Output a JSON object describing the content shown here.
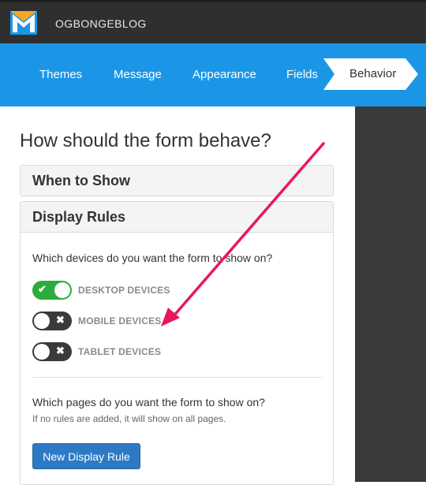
{
  "header": {
    "brand": "OGBONGEBLOG",
    "logo_icon": "envelope-m-logo-icon"
  },
  "nav": {
    "tabs": [
      {
        "label": "Themes"
      },
      {
        "label": "Message"
      },
      {
        "label": "Appearance"
      },
      {
        "label": "Fields"
      },
      {
        "label": "Behavior",
        "active": true
      }
    ]
  },
  "main": {
    "heading": "How should the form behave?",
    "when_to_show": {
      "title": "When to Show"
    },
    "display_rules": {
      "title": "Display Rules",
      "devices_question": "Which devices do you want the form to show on?",
      "devices": [
        {
          "label": "DESKTOP DEVICES",
          "enabled": true,
          "glyph": "✔"
        },
        {
          "label": "MOBILE DEVICES",
          "enabled": false,
          "glyph": "✖"
        },
        {
          "label": "TABLET DEVICES",
          "enabled": false,
          "glyph": "✖"
        }
      ],
      "pages_question": "Which pages do you want the form to show on?",
      "pages_hint": "If no rules are added, it will show on all pages.",
      "button": "New Display Rule"
    }
  },
  "colors": {
    "topbar": "#2f2f2f",
    "nav": "#1b96e6",
    "toggle_on": "#2cac3d",
    "toggle_off": "#3a3a3a",
    "button": "#2d7ac4",
    "annotation_arrow": "#e8185f"
  }
}
